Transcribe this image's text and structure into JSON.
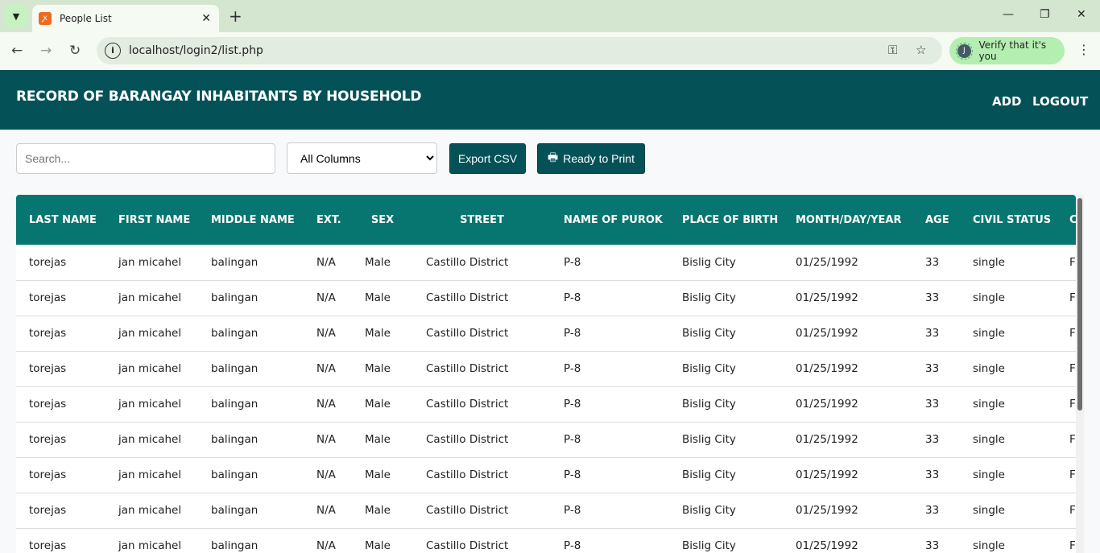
{
  "browser": {
    "tab_title": "People List",
    "url": "localhost/login2/list.php",
    "verify_label": "Verify that it's you",
    "avatar_initial": "J"
  },
  "header": {
    "title": "RECORD OF BARANGAY INHABITANTS BY HOUSEHOLD",
    "add": "ADD",
    "logout": "LOGOUT"
  },
  "toolbar": {
    "search_placeholder": "Search...",
    "filter_selected": "All Columns",
    "export": "Export CSV",
    "print": "Ready to Print"
  },
  "table": {
    "columns": [
      "LAST NAME",
      "FIRST NAME",
      "MIDDLE NAME",
      "EXT.",
      "SEX",
      "STREET",
      "NAME OF PUROK",
      "PLACE OF BIRTH",
      "MONTH/DAY/YEAR",
      "AGE",
      "CIVIL STATUS",
      "C"
    ],
    "rows": [
      [
        "torejas",
        "jan micahel",
        "balingan",
        "N/A",
        "Male",
        "Castillo District",
        "P-8",
        "Bislig City",
        "01/25/1992",
        "33",
        "single",
        "Fi"
      ],
      [
        "torejas",
        "jan micahel",
        "balingan",
        "N/A",
        "Male",
        "Castillo District",
        "P-8",
        "Bislig City",
        "01/25/1992",
        "33",
        "single",
        "Fi"
      ],
      [
        "torejas",
        "jan micahel",
        "balingan",
        "N/A",
        "Male",
        "Castillo District",
        "P-8",
        "Bislig City",
        "01/25/1992",
        "33",
        "single",
        "Fi"
      ],
      [
        "torejas",
        "jan micahel",
        "balingan",
        "N/A",
        "Male",
        "Castillo District",
        "P-8",
        "Bislig City",
        "01/25/1992",
        "33",
        "single",
        "Fi"
      ],
      [
        "torejas",
        "jan micahel",
        "balingan",
        "N/A",
        "Male",
        "Castillo District",
        "P-8",
        "Bislig City",
        "01/25/1992",
        "33",
        "single",
        "Fi"
      ],
      [
        "torejas",
        "jan micahel",
        "balingan",
        "N/A",
        "Male",
        "Castillo District",
        "P-8",
        "Bislig City",
        "01/25/1992",
        "33",
        "single",
        "Fi"
      ],
      [
        "torejas",
        "jan micahel",
        "balingan",
        "N/A",
        "Male",
        "Castillo District",
        "P-8",
        "Bislig City",
        "01/25/1992",
        "33",
        "single",
        "Fi"
      ],
      [
        "torejas",
        "jan micahel",
        "balingan",
        "N/A",
        "Male",
        "Castillo District",
        "P-8",
        "Bislig City",
        "01/25/1992",
        "33",
        "single",
        "Fi"
      ],
      [
        "torejas",
        "jan micahel",
        "balingan",
        "N/A",
        "Male",
        "Castillo District",
        "P-8",
        "Bislig City",
        "01/25/1992",
        "33",
        "single",
        "Fi"
      ]
    ]
  }
}
